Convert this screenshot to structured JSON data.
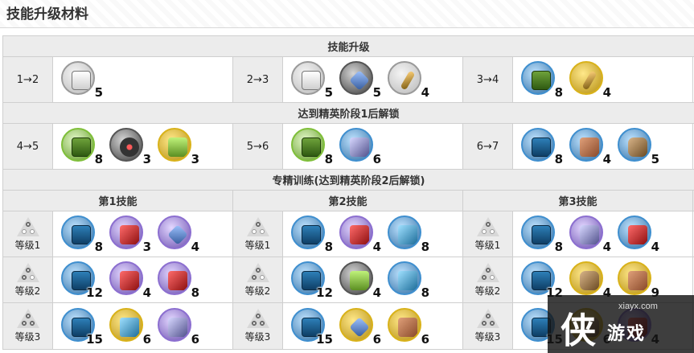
{
  "page_title": "技能升级材料",
  "sections": {
    "skill_upgrade": "技能升级",
    "elite1": "达到精英阶段1后解锁",
    "mastery": "专精训练(达到精英阶段2后解锁)"
  },
  "upgrade_rows": [
    {
      "cells": [
        {
          "label": "1→2",
          "items": [
            {
              "icon": "skill-book-1-icon",
              "qty": "5",
              "style": "silver",
              "glyph": "book-w"
            }
          ]
        },
        {
          "label": "2→3",
          "items": [
            {
              "icon": "skill-book-1-icon",
              "qty": "5",
              "style": "silver",
              "glyph": "book-w"
            },
            {
              "icon": "crystal-shard-icon",
              "qty": "5",
              "style": "dark",
              "glyph": "crystal"
            },
            {
              "icon": "device-part-icon",
              "qty": "4",
              "style": "silver",
              "glyph": "tool"
            }
          ]
        },
        {
          "label": "3→4",
          "items": [
            {
              "icon": "skill-book-2-icon",
              "qty": "8",
              "style": "blue",
              "glyph": "book-g"
            },
            {
              "icon": "tool-kit-icon",
              "qty": "4",
              "style": "gold",
              "glyph": "tool"
            }
          ]
        }
      ]
    },
    {
      "cells": [
        {
          "label": "4→5",
          "items": [
            {
              "icon": "skill-book-2-icon",
              "qty": "8",
              "style": "green",
              "glyph": "book-g"
            },
            {
              "icon": "dark-device-icon",
              "qty": "3",
              "style": "dark",
              "glyph": "dark"
            },
            {
              "icon": "green-box-icon",
              "qty": "3",
              "style": "gold",
              "glyph": "green"
            }
          ]
        },
        {
          "label": "5→6",
          "items": [
            {
              "icon": "skill-book-2-icon",
              "qty": "8",
              "style": "green",
              "glyph": "book-g"
            },
            {
              "icon": "purple-crystal-icon",
              "qty": "6",
              "style": "blue",
              "glyph": "cube"
            }
          ]
        },
        {
          "label": "6→7",
          "items": [
            {
              "icon": "skill-book-3-icon",
              "qty": "8",
              "style": "blue",
              "glyph": "book-b"
            },
            {
              "icon": "wood-block-icon",
              "qty": "4",
              "style": "blue",
              "glyph": "wood"
            },
            {
              "icon": "rock-cluster-icon",
              "qty": "5",
              "style": "blue",
              "glyph": "rock"
            }
          ]
        }
      ]
    }
  ],
  "mastery_heads": [
    "第1技能",
    "第2技能",
    "第3技能"
  ],
  "mastery_rows": [
    {
      "cells": [
        {
          "label": "等级1",
          "dots": 1,
          "items": [
            {
              "icon": "skill-book-3-icon",
              "qty": "8",
              "style": "blue",
              "glyph": "book-b"
            },
            {
              "icon": "red-cube-icon",
              "qty": "3",
              "style": "purple",
              "glyph": "red"
            },
            {
              "icon": "blue-shard-icon",
              "qty": "4",
              "style": "purple",
              "glyph": "crystal"
            }
          ]
        },
        {
          "label": "等级1",
          "dots": 1,
          "items": [
            {
              "icon": "skill-book-3-icon",
              "qty": "8",
              "style": "blue",
              "glyph": "book-b"
            },
            {
              "icon": "red-device-icon",
              "qty": "4",
              "style": "purple",
              "glyph": "red"
            },
            {
              "icon": "capsule-icon",
              "qty": "8",
              "style": "blue",
              "glyph": "chip"
            }
          ]
        },
        {
          "label": "等级1",
          "dots": 1,
          "items": [
            {
              "icon": "skill-book-3-icon",
              "qty": "8",
              "style": "blue",
              "glyph": "book-b"
            },
            {
              "icon": "purple-cube-icon",
              "qty": "4",
              "style": "purple",
              "glyph": "cube"
            },
            {
              "icon": "red-cube-icon",
              "qty": "4",
              "style": "blue",
              "glyph": "red"
            }
          ]
        }
      ]
    },
    {
      "cells": [
        {
          "label": "等级2",
          "dots": 2,
          "items": [
            {
              "icon": "skill-book-3-icon",
              "qty": "12",
              "style": "blue",
              "glyph": "book-b"
            },
            {
              "icon": "red-star-icon",
              "qty": "4",
              "style": "purple",
              "glyph": "red"
            },
            {
              "icon": "red-device-icon",
              "qty": "8",
              "style": "purple",
              "glyph": "red"
            }
          ]
        },
        {
          "label": "等级2",
          "dots": 2,
          "items": [
            {
              "icon": "skill-book-3-icon",
              "qty": "12",
              "style": "blue",
              "glyph": "book-b"
            },
            {
              "icon": "green-device-icon",
              "qty": "4",
              "style": "dark",
              "glyph": "green"
            },
            {
              "icon": "blue-crystal-icon",
              "qty": "8",
              "style": "blue",
              "glyph": "chip"
            }
          ]
        },
        {
          "label": "等级2",
          "dots": 2,
          "items": [
            {
              "icon": "skill-book-3-icon",
              "qty": "12",
              "style": "blue",
              "glyph": "book-b"
            },
            {
              "icon": "gold-rock-icon",
              "qty": "4",
              "style": "gold",
              "glyph": "rock"
            },
            {
              "icon": "wood-block-icon",
              "qty": "9",
              "style": "gold",
              "glyph": "wood"
            }
          ]
        }
      ]
    },
    {
      "cells": [
        {
          "label": "等级3",
          "dots": 3,
          "items": [
            {
              "icon": "skill-book-3-icon",
              "qty": "15",
              "style": "blue",
              "glyph": "book-b"
            },
            {
              "icon": "blue-device-icon",
              "qty": "6",
              "style": "gold",
              "glyph": "chip"
            },
            {
              "icon": "purple-cube-icon",
              "qty": "6",
              "style": "purple",
              "glyph": "cube"
            }
          ]
        },
        {
          "label": "等级3",
          "dots": 3,
          "items": [
            {
              "icon": "skill-book-3-icon",
              "qty": "15",
              "style": "blue",
              "glyph": "book-b"
            },
            {
              "icon": "crystal-cluster-icon",
              "qty": "6",
              "style": "gold",
              "glyph": "crystal"
            },
            {
              "icon": "wood-block-icon",
              "qty": "6",
              "style": "gold",
              "glyph": "wood"
            }
          ]
        },
        {
          "label": "等级3",
          "dots": 3,
          "items": [
            {
              "icon": "skill-book-3-icon",
              "qty": "15",
              "style": "blue",
              "glyph": "book-b"
            },
            {
              "icon": "gold-rock-icon",
              "qty": "6",
              "style": "gold",
              "glyph": "rock"
            },
            {
              "icon": "red-cube-icon",
              "qty": "4",
              "style": "purple",
              "glyph": "red"
            }
          ]
        }
      ]
    }
  ],
  "watermark": {
    "url": "xiayx.com",
    "logo": "侠",
    "text": "游戏"
  }
}
